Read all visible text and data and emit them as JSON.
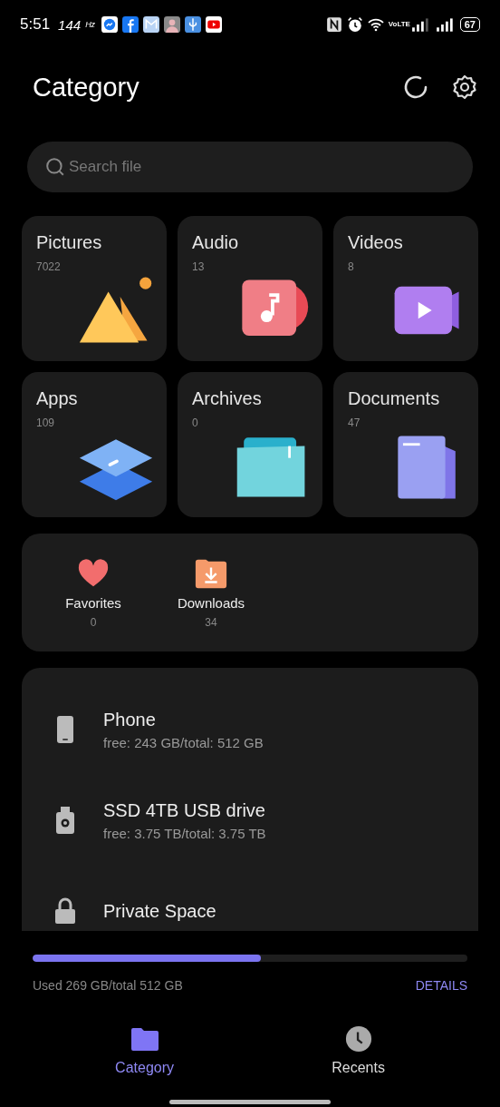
{
  "status_bar": {
    "time": "5:51",
    "refresh_rate": "144",
    "refresh_unit": "Hz",
    "notifications": [
      {
        "kind": "messenger"
      },
      {
        "kind": "facebook"
      },
      {
        "kind": "mail"
      },
      {
        "kind": "avatar"
      },
      {
        "kind": "usb"
      },
      {
        "kind": "youtube"
      }
    ],
    "network": "VoLTE",
    "battery": "67"
  },
  "header": {
    "title": "Category"
  },
  "search": {
    "placeholder": "Search file"
  },
  "categories": [
    {
      "kind": "pictures",
      "label": "Pictures",
      "count": "7022"
    },
    {
      "kind": "audio",
      "label": "Audio",
      "count": "13"
    },
    {
      "kind": "videos",
      "label": "Videos",
      "count": "8"
    },
    {
      "kind": "apps",
      "label": "Apps",
      "count": "109"
    },
    {
      "kind": "archives",
      "label": "Archives",
      "count": "0"
    },
    {
      "kind": "documents",
      "label": "Documents",
      "count": "47"
    }
  ],
  "shortcuts": [
    {
      "kind": "favorites",
      "label": "Favorites",
      "count": "0"
    },
    {
      "kind": "downloads",
      "label": "Downloads",
      "count": "34"
    }
  ],
  "storage_locations": [
    {
      "kind": "phone",
      "name": "Phone",
      "detail": "free: 243 GB/total: 512 GB"
    },
    {
      "kind": "usb",
      "name": "SSD 4TB USB drive",
      "detail": "free: 3.75 TB/total: 3.75 TB"
    },
    {
      "kind": "private",
      "name": "Private Space"
    }
  ],
  "usage": {
    "level": 0.525,
    "text": "Used 269 GB/total 512 GB",
    "action": "DETAILS"
  },
  "bottom_nav": [
    {
      "kind": "category",
      "label": "Category",
      "selected": true
    },
    {
      "kind": "recents",
      "label": "Recents",
      "selected": false
    }
  ]
}
